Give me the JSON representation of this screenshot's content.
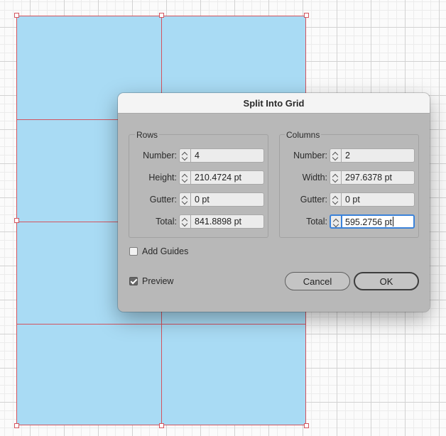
{
  "dialog": {
    "title": "Split Into Grid",
    "rows": {
      "label": "Rows",
      "number_label": "Number:",
      "number_value": "4",
      "height_label": "Height:",
      "height_value": "210.4724 pt",
      "gutter_label": "Gutter:",
      "gutter_value": "0 pt",
      "total_label": "Total:",
      "total_value": "841.8898 pt"
    },
    "columns": {
      "label": "Columns",
      "number_label": "Number:",
      "number_value": "2",
      "width_label": "Width:",
      "width_value": "297.6378 pt",
      "gutter_label": "Gutter:",
      "gutter_value": "0 pt",
      "total_label": "Total:",
      "total_value": "595.2756 pt"
    },
    "add_guides": {
      "label": "Add Guides",
      "checked": false
    },
    "preview": {
      "label": "Preview",
      "checked": true
    },
    "buttons": {
      "cancel": "Cancel",
      "ok": "OK"
    }
  },
  "colors": {
    "artboard_fill": "#a9dbf4",
    "selection_red": "#d3545e",
    "focus_blue": "#3b82d9"
  },
  "icons": [
    "stepper-arrows-icon",
    "checkbox-icon",
    "checkmark-icon",
    "selection-handle"
  ]
}
